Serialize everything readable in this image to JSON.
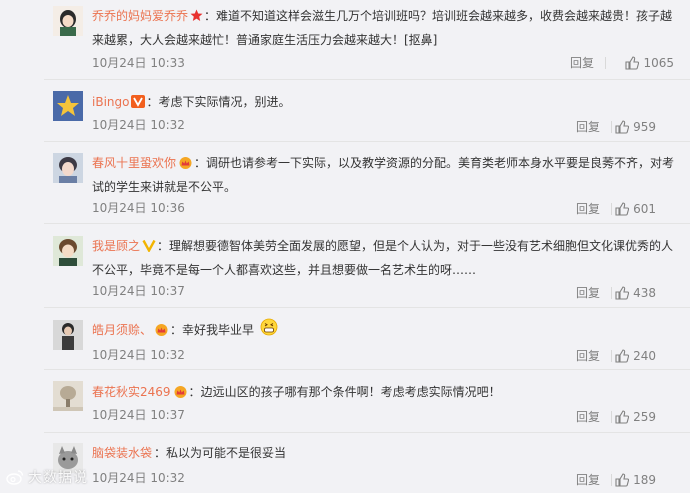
{
  "comments": [
    {
      "username": "乔乔的妈妈爱乔乔",
      "badge": "red-star-icon",
      "colon": "：",
      "text": "难道不知道这样会滋生几万个培训班吗？培训班会越来越多，收费会越来越贵！孩子越来越累，大人会越来越忙！普通家庭生活压力会越来越大！[抠鼻]",
      "date": "10月24日 10:33",
      "reply": "回复",
      "likes": "1065"
    },
    {
      "username": "iBingo",
      "badge": "orange-v-icon",
      "colon": "：",
      "text": "考虑下实际情况，别进。",
      "date": "10月24日 10:32",
      "reply": "回复",
      "likes": "959"
    },
    {
      "username": "春风十里蛩欢你",
      "badge": "crown-icon",
      "colon": "：",
      "text": "调研也请参考一下实际，以及教学资源的分配。美育类老师本身水平要是良莠不齐，对考试的学生来讲就是不公平。",
      "date": "10月24日 10:36",
      "reply": "回复",
      "likes": "601"
    },
    {
      "username": "我是顾之",
      "badge": "yellow-v-icon",
      "colon": "：",
      "text": "理解想要德智体美劳全面发展的愿望，但是个人认为，对于一些没有艺术细胞但文化课优秀的人不公平，毕竟不是每一个人都喜欢这些，并且想要做一名艺术生的呀……",
      "date": "10月24日 10:37",
      "reply": "回复",
      "likes": "438"
    },
    {
      "username": "皓月须赊、",
      "badge": "crown-icon",
      "colon": "：",
      "text": "幸好我毕业早",
      "emoji": "grin-emoji-icon",
      "date": "10月24日 10:32",
      "reply": "回复",
      "likes": "240"
    },
    {
      "username": "春花秋实2469",
      "badge": "crown-icon",
      "colon": "：",
      "text": "边远山区的孩子哪有那个条件啊！考虑考虑实际情况吧！",
      "date": "10月24日 10:37",
      "reply": "回复",
      "likes": "259"
    },
    {
      "username": "脑袋装水袋",
      "badge": "",
      "colon": "：",
      "text": "私以为可能不是很妥当",
      "date": "10月24日 10:32",
      "reply": "回复",
      "likes": "189"
    }
  ],
  "watermark": {
    "text": "大数据说",
    "icon": "weibo-icon"
  },
  "colors": {
    "username": "#eb7350",
    "meta": "#808080",
    "text": "#333333",
    "background": "#f2f2f5"
  }
}
